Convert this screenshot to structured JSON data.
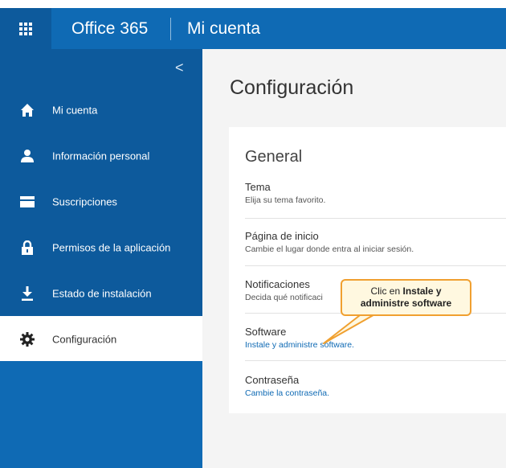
{
  "topbar": {
    "brand": "Office 365",
    "app_title": "Mi cuenta"
  },
  "sidebar": {
    "collapse_glyph": "<",
    "items": [
      {
        "label": "Mi cuenta",
        "icon": "home-icon"
      },
      {
        "label": "Información personal",
        "icon": "person-icon"
      },
      {
        "label": "Suscripciones",
        "icon": "card-icon"
      },
      {
        "label": "Permisos de la aplicación",
        "icon": "lock-icon"
      },
      {
        "label": "Estado de instalación",
        "icon": "download-icon"
      },
      {
        "label": "Configuración",
        "icon": "gear-icon",
        "active": true
      }
    ]
  },
  "main": {
    "page_title": "Configuración",
    "section_title": "General",
    "rows": [
      {
        "title": "Tema",
        "desc": "Elija su tema favorito."
      },
      {
        "title": "Página de inicio",
        "desc": "Cambie el lugar donde entra al iniciar sesión."
      },
      {
        "title": "Notificaciones",
        "desc": "Decida qué notificaci"
      },
      {
        "title": "Software",
        "desc": "Instale y administre software."
      },
      {
        "title": "Contraseña",
        "desc": "Cambie la contraseña."
      }
    ]
  },
  "callout": {
    "line1_plain": "Clic en ",
    "line1_bold": "Instale y",
    "line2_bold": "administre software"
  },
  "colors": {
    "topbar": "#0f6ab4",
    "sidebar": "#0d5a9c",
    "link": "#0f6ab4",
    "callout_border": "#f0a030"
  }
}
